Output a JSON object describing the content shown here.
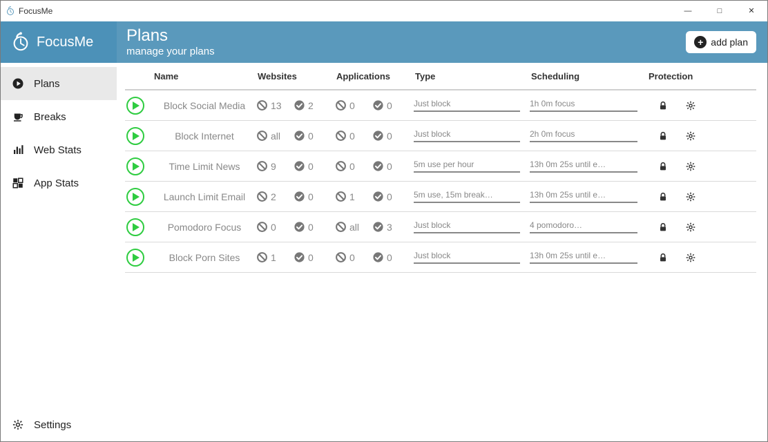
{
  "window": {
    "title": "FocusMe"
  },
  "brand": {
    "name": "FocusMe"
  },
  "sidebar": {
    "items": [
      {
        "label": "Plans",
        "icon": "play-circle",
        "active": true
      },
      {
        "label": "Breaks",
        "icon": "cup",
        "active": false
      },
      {
        "label": "Web Stats",
        "icon": "bar-chart",
        "active": false
      },
      {
        "label": "App Stats",
        "icon": "app-grid",
        "active": false
      }
    ],
    "settings_label": "Settings"
  },
  "header": {
    "title": "Plans",
    "subtitle": "manage your plans",
    "add_button_label": "add plan"
  },
  "columns": {
    "name": "Name",
    "websites": "Websites",
    "applications": "Applications",
    "type": "Type",
    "scheduling": "Scheduling",
    "protection": "Protection"
  },
  "plans": [
    {
      "name": "Block Social Media",
      "web_block": "13",
      "web_allow": "2",
      "app_block": "0",
      "app_allow": "0",
      "type": "Just block",
      "scheduling": "1h 0m focus"
    },
    {
      "name": "Block Internet",
      "web_block": "all",
      "web_allow": "0",
      "app_block": "0",
      "app_allow": "0",
      "type": "Just block",
      "scheduling": "2h 0m focus"
    },
    {
      "name": "Time Limit News",
      "web_block": "9",
      "web_allow": "0",
      "app_block": "0",
      "app_allow": "0",
      "type": "5m use per hour",
      "scheduling": "13h 0m 25s until e…"
    },
    {
      "name": "Launch Limit Email",
      "web_block": "2",
      "web_allow": "0",
      "app_block": "1",
      "app_allow": "0",
      "type": "5m use, 15m break…",
      "scheduling": "13h 0m 25s until e…"
    },
    {
      "name": "Pomodoro Focus",
      "web_block": "0",
      "web_allow": "0",
      "app_block": "all",
      "app_allow": "3",
      "type": "Just block",
      "scheduling": "4 pomodoro…"
    },
    {
      "name": "Block Porn Sites",
      "web_block": "1",
      "web_allow": "0",
      "app_block": "0",
      "app_allow": "0",
      "type": "Just block",
      "scheduling": "13h 0m 25s until e…"
    }
  ]
}
